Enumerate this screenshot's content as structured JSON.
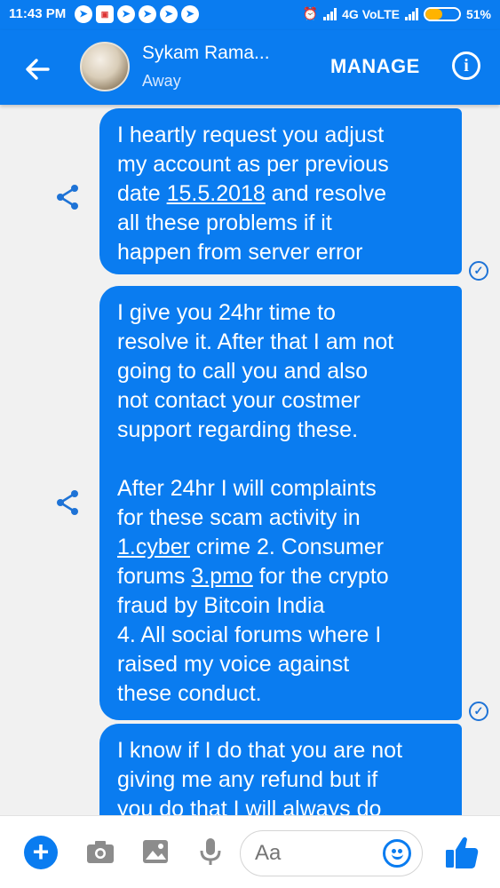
{
  "status_bar": {
    "time": "11:43 PM",
    "network": "4G VoLTE",
    "battery": "51%",
    "battery_level": 0.51,
    "left_icons": [
      "telegram-icon",
      "app-icon",
      "telegram-icon",
      "telegram-icon",
      "telegram-icon",
      "telegram-icon"
    ]
  },
  "header": {
    "contact_name": "Sykam Rama...",
    "contact_status": "Away",
    "manage_label": "MANAGE",
    "info_icon": "i"
  },
  "messages": [
    {
      "lines": [
        {
          "parts": [
            {
              "t": "I heartly request you adjust"
            }
          ]
        },
        {
          "parts": [
            {
              "t": "my account as per previous"
            }
          ]
        },
        {
          "parts": [
            {
              "t": "date "
            },
            {
              "t": "15.5.2018",
              "link": true
            },
            {
              "t": " and resolve"
            }
          ]
        },
        {
          "parts": [
            {
              "t": "all these problems if it"
            }
          ]
        },
        {
          "parts": [
            {
              "t": "happen from server error"
            }
          ]
        }
      ],
      "read": true
    },
    {
      "lines": [
        {
          "parts": [
            {
              "t": "I give you 24hr time to"
            }
          ]
        },
        {
          "parts": [
            {
              "t": "resolve it. After that I am not"
            }
          ]
        },
        {
          "parts": [
            {
              "t": "going to call you and also"
            }
          ]
        },
        {
          "parts": [
            {
              "t": "not contact your costmer"
            }
          ]
        },
        {
          "parts": [
            {
              "t": "support regarding these."
            }
          ]
        },
        {
          "parts": []
        },
        {
          "parts": [
            {
              "t": "After 24hr I will complaints"
            }
          ]
        },
        {
          "parts": [
            {
              "t": "for these scam activity in"
            }
          ]
        },
        {
          "parts": [
            {
              "t": "1.cyber",
              "link": true
            },
            {
              "t": " crime 2. Consumer"
            }
          ]
        },
        {
          "parts": [
            {
              "t": "forums "
            },
            {
              "t": "3.pmo",
              "link": true
            },
            {
              "t": " for the crypto"
            }
          ]
        },
        {
          "parts": [
            {
              "t": "fraud by Bitcoin India"
            }
          ]
        },
        {
          "parts": [
            {
              "t": "4. All social forums where I"
            }
          ]
        },
        {
          "parts": [
            {
              "t": "raised my voice against"
            }
          ]
        },
        {
          "parts": [
            {
              "t": "these conduct."
            }
          ]
        }
      ],
      "read": true
    },
    {
      "lines": [
        {
          "parts": [
            {
              "t": "I know if I do that you are not"
            }
          ]
        },
        {
          "parts": [
            {
              "t": "giving me any refund but if"
            }
          ]
        },
        {
          "parts": [
            {
              "t": "you do that I will always do"
            }
          ]
        }
      ],
      "read": false
    }
  ],
  "composer": {
    "placeholder": "Aa",
    "icons": [
      "plus-icon",
      "camera-icon",
      "image-icon",
      "microphone-icon",
      "emoji-icon",
      "thumbs-up-icon"
    ]
  },
  "colors": {
    "brand_blue": "#0a7cf0",
    "chat_background": "#f1f1f1",
    "battery_fill": "#ffb300"
  }
}
